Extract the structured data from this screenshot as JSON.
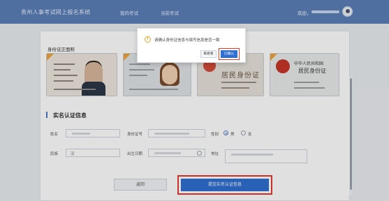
{
  "header": {
    "brand": "贵州人事考试网上报名系统",
    "nav": [
      "我的考试",
      "当前考试"
    ],
    "welcome": "欢迎，"
  },
  "id_section": {
    "title": "身份证正面照"
  },
  "id_samples": {
    "card3_title": "居民身份证",
    "card4_title_small": "中华人民共和国",
    "card4_title_large": "居民身份证"
  },
  "form_section": {
    "title": "实名认证信息",
    "fields": {
      "name_label": "姓名",
      "id_label": "身份证号",
      "gender_label": "性别",
      "gender_options": [
        "男",
        "女"
      ],
      "gender_selected": "男",
      "ethnicity_label": "民族",
      "ethnicity_value": "汉",
      "birthdate_label": "出生日期",
      "address_label": "地址"
    }
  },
  "actions": {
    "back_label": "返回",
    "submit_label": "提交实名认证信息"
  },
  "modal": {
    "warning_icon": "!",
    "message": "请确认身份证信息与填写信息是否一致",
    "recheck_label": "再看看",
    "confirm_label": "已确认"
  },
  "colors": {
    "nav_bg": "#5b7fb8",
    "primary": "#2f6fd1",
    "highlight": "#e23a2d",
    "warning": "#f0a31c"
  }
}
